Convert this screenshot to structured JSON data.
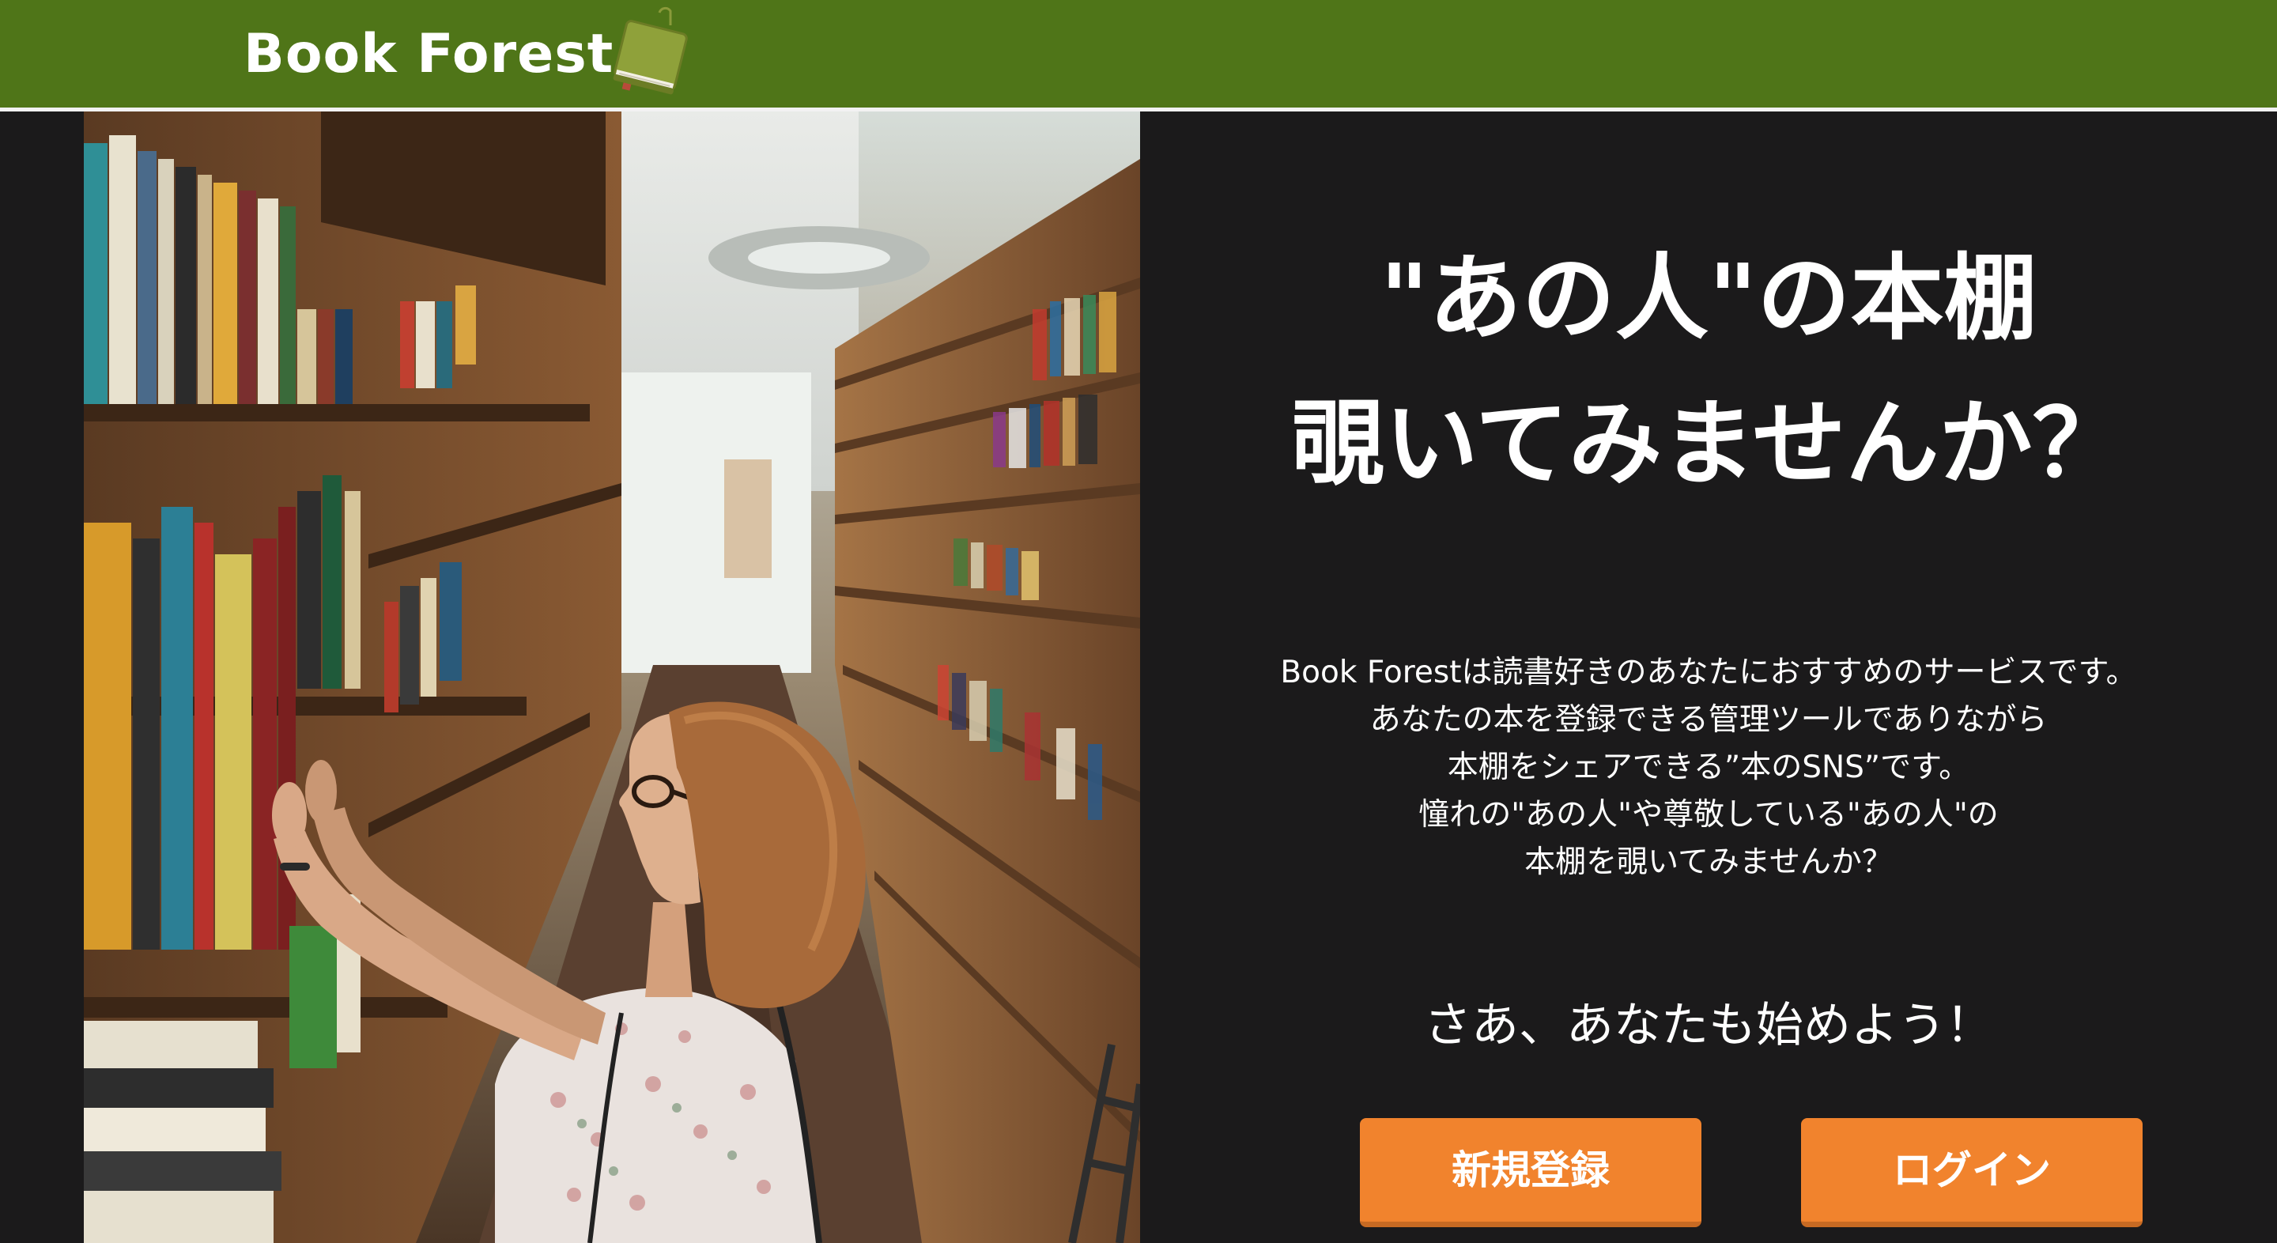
{
  "header": {
    "logo_text": "Book Forest",
    "logo_icon": "book-icon",
    "brand_color": "#4f7518"
  },
  "hero": {
    "image_subject": "woman browsing library bookshelves",
    "headline_line1": "\"あの人\"の本棚",
    "headline_line2": "覗いてみませんか？",
    "description": [
      "Book Forestは読書好きのあなたにおすすめのサービスです。",
      "あなたの本を登録できる管理ツールでありながら",
      "本棚をシェアできる”本のSNS”です。",
      "憧れの\"あの人\"や尊敬している\"あの人\"の",
      "本棚を覗いてみませんか？"
    ],
    "cta_text": "さあ、あなたも始めよう！",
    "register_label": "新規登録",
    "login_label": "ログイン",
    "accent_color": "#f1832d",
    "panel_color": "#1b1a1b"
  }
}
